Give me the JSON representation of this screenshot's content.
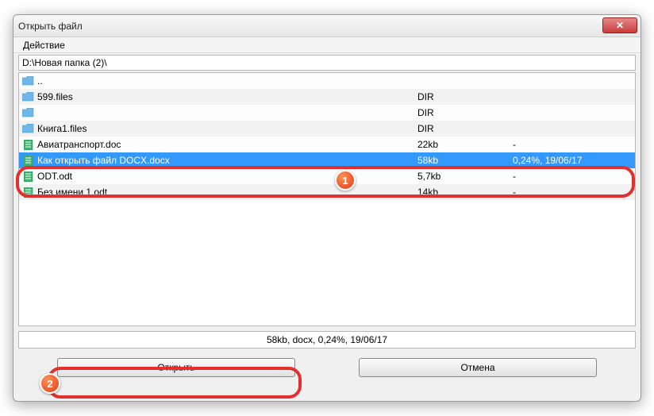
{
  "window": {
    "title": "Открыть файл",
    "close_glyph": "✕"
  },
  "menubar": {
    "action": "Действие"
  },
  "path": "D:\\Новая папка (2)\\",
  "files": [
    {
      "name": "..",
      "size": "",
      "date": "",
      "kind": "folder-up"
    },
    {
      "name": "599.files",
      "size": "DIR",
      "date": "",
      "kind": "folder"
    },
    {
      "name": "",
      "size": "DIR",
      "date": "",
      "kind": "folder"
    },
    {
      "name": "Книга1.files",
      "size": "DIR",
      "date": "",
      "kind": "folder"
    },
    {
      "name": "Авиатранспорт.doc",
      "size": "22kb",
      "date": "-",
      "kind": "doc"
    },
    {
      "name": "Как открыть файл DOCX.docx",
      "size": "58kb",
      "date": "0,24%, 19/06/17",
      "kind": "doc",
      "selected": true
    },
    {
      "name": "ODT.odt",
      "size": "5,7kb",
      "date": "-",
      "kind": "doc"
    },
    {
      "name": "Без имени 1.odt",
      "size": "14kb",
      "date": "-",
      "kind": "doc"
    }
  ],
  "status": "58kb, docx, 0,24%, 19/06/17",
  "buttons": {
    "open": "Открыть",
    "cancel": "Отмена"
  },
  "badges": {
    "one": "1",
    "two": "2"
  }
}
